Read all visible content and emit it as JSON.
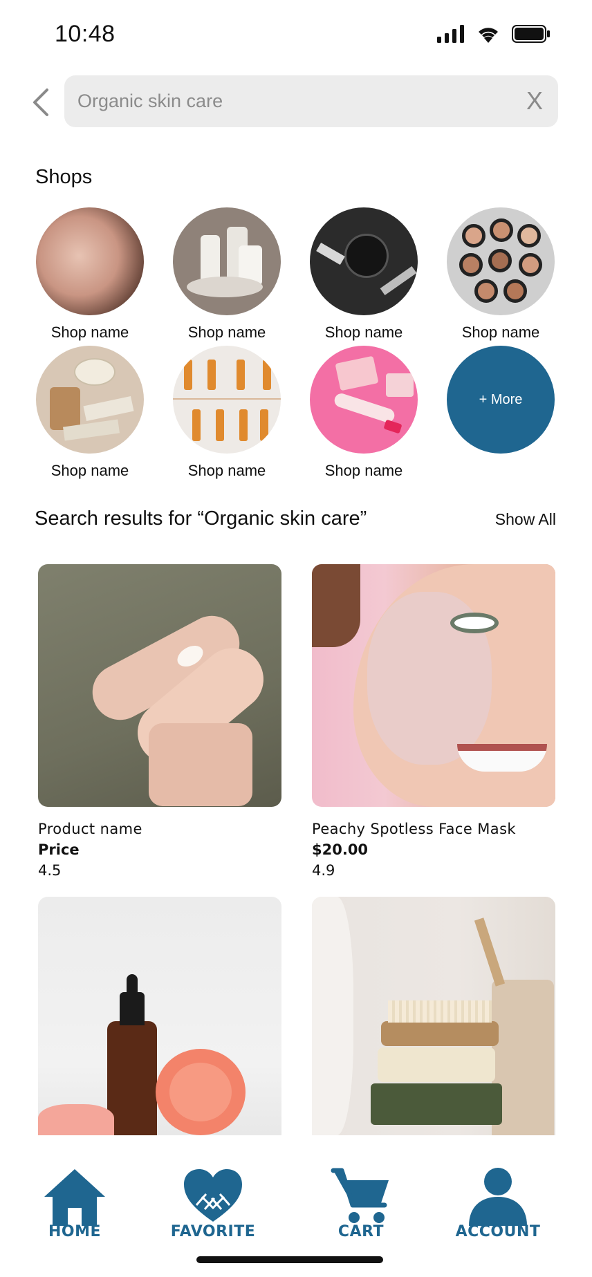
{
  "status_bar": {
    "time": "10:48"
  },
  "search": {
    "value": "",
    "placeholder": "Organic skin care",
    "clear_label": "X"
  },
  "shops": {
    "title": "Shops",
    "items": [
      {
        "label": "Shop name"
      },
      {
        "label": "Shop name"
      },
      {
        "label": "Shop name"
      },
      {
        "label": "Shop name"
      },
      {
        "label": "Shop name"
      },
      {
        "label": "Shop name"
      },
      {
        "label": "Shop name"
      }
    ],
    "more_label": "+ More"
  },
  "results": {
    "title": "Search results for “Organic skin care”",
    "show_all": "Show All",
    "products": [
      {
        "name": "Product name",
        "price": "Price",
        "rating": "4.5"
      },
      {
        "name": "Peachy Spotless Face Mask",
        "price": "$20.00",
        "rating": "4.9"
      }
    ]
  },
  "nav": {
    "home": "HOME",
    "favorite": "FAVORITE",
    "cart": "CART",
    "account": "ACCOUNT"
  },
  "colors": {
    "accent": "#1f6690",
    "search_bg": "#ececec"
  }
}
